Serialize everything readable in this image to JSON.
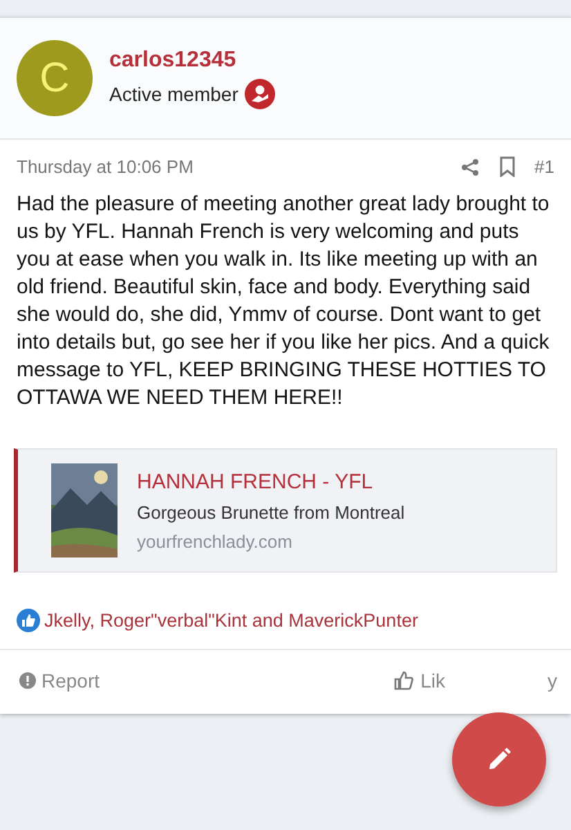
{
  "author": {
    "avatar_letter": "C",
    "username": "carlos12345",
    "title": "Active member"
  },
  "post": {
    "date": "Thursday at 10:06 PM",
    "number": "#1",
    "body": "Had the pleasure of meeting another great lady brought to us by YFL. Hannah French is very welcoming and puts you at ease when you walk in. Its like meeting up with an old friend. Beautiful skin, face and body. Everything said she would do, she did, Ymmv of course. Dont want to get into details but, go see her if you like her pics. And a quick message to YFL, KEEP BRINGING THESE HOTTIES TO OTTAWA WE NEED THEM HERE!!",
    "link_preview": {
      "kind": "picture",
      "title": "HANNAH FRENCH - YFL",
      "description": "Gorgeous Brunette from Montreal",
      "domain": "yourfrenchlady.com"
    },
    "reactions": "Jkelly, Roger\"verbal\"Kint and MaverickPunter",
    "actions": [
      {
        "kind": "report",
        "label": "Report"
      },
      {
        "kind": "like",
        "label": "Lik"
      },
      {
        "kind": "reply",
        "label": "y"
      }
    ]
  }
}
